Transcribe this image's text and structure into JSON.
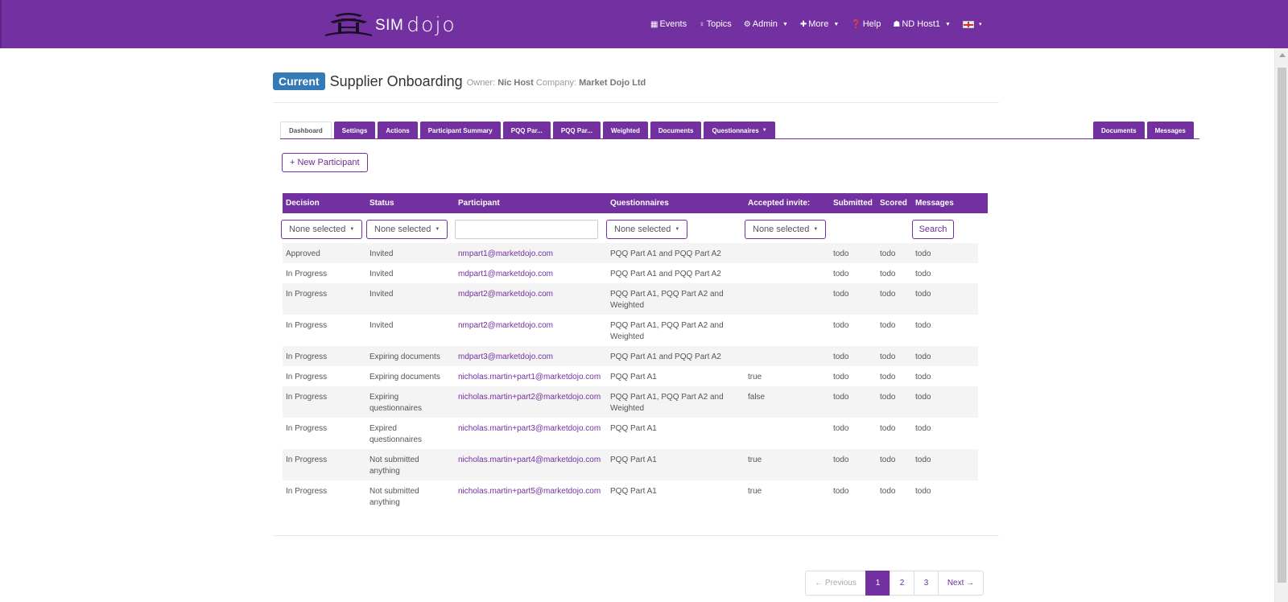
{
  "nav": {
    "brand_sim": "SIM",
    "brand_dojo": "dojo",
    "items": [
      {
        "icon": "calendar-icon",
        "glyph": "▦",
        "label": "Events",
        "caret": ""
      },
      {
        "icon": "lightbulb-icon",
        "glyph": "♀",
        "label": "Topics",
        "caret": ""
      },
      {
        "icon": "cogs-icon",
        "glyph": "⚙",
        "label": "Admin",
        "caret": "▼"
      },
      {
        "icon": "plus-icon",
        "glyph": "✚",
        "label": "More",
        "caret": "▼"
      },
      {
        "icon": "question-icon",
        "glyph": "❓",
        "label": "Help",
        "caret": ""
      },
      {
        "icon": "user-icon",
        "glyph": "☗",
        "label": "ND Host1",
        "caret": "▼"
      }
    ],
    "language_caret": "▾"
  },
  "header": {
    "badge": "Current",
    "title": "Supplier Onboarding",
    "owner_label": "Owner:",
    "owner": "Nic Host",
    "company_label": "Company:",
    "company": "Market Dojo Ltd"
  },
  "tabs": {
    "left": [
      "Dashboard",
      "Settings",
      "Actions",
      "Participant Summary",
      "PQQ Par...",
      "PQQ Par...",
      "Weighted",
      "Documents",
      "Questionnaires"
    ],
    "questionnaires_caret": "▼",
    "right": [
      "Documents",
      "Messages"
    ],
    "active": "Dashboard"
  },
  "new_participant_label": "+ New Participant",
  "table": {
    "columns": [
      "Decision",
      "Status",
      "Participant",
      "Questionnaires",
      "Accepted invite:",
      "Submitted",
      "Scored",
      "Messages"
    ],
    "filters": {
      "decision": "None selected",
      "status": "None selected",
      "participant": "",
      "questionnaires": "None selected",
      "accepted": "None selected",
      "search_label": "Search"
    },
    "rows": [
      {
        "decision": "Approved",
        "status": [
          "Invited"
        ],
        "participant": "nmpart1@marketdojo.com",
        "questionnaires": [
          "PQQ Part A1 and PQQ Part A2"
        ],
        "accepted": "",
        "submitted": "todo",
        "scored": "todo",
        "messages": "todo"
      },
      {
        "decision": "In Progress",
        "status": [
          "Invited"
        ],
        "participant": "mdpart1@marketdojo.com",
        "questionnaires": [
          "PQQ Part A1 and PQQ Part A2"
        ],
        "accepted": "",
        "submitted": "todo",
        "scored": "todo",
        "messages": "todo"
      },
      {
        "decision": "In Progress",
        "status": [
          "Invited"
        ],
        "participant": "mdpart2@marketdojo.com",
        "questionnaires": [
          "PQQ Part A1, PQQ Part A2 and",
          "Weighted"
        ],
        "accepted": "",
        "submitted": "todo",
        "scored": "todo",
        "messages": "todo"
      },
      {
        "decision": "In Progress",
        "status": [
          "Invited"
        ],
        "participant": "nmpart2@marketdojo.com",
        "questionnaires": [
          "PQQ Part A1, PQQ Part A2 and",
          "Weighted"
        ],
        "accepted": "",
        "submitted": "todo",
        "scored": "todo",
        "messages": "todo"
      },
      {
        "decision": "In Progress",
        "status": [
          "Expiring documents"
        ],
        "participant": "mdpart3@marketdojo.com",
        "questionnaires": [
          "PQQ Part A1 and PQQ Part A2"
        ],
        "accepted": "",
        "submitted": "todo",
        "scored": "todo",
        "messages": "todo"
      },
      {
        "decision": "In Progress",
        "status": [
          "Expiring documents"
        ],
        "participant": "nicholas.martin+part1@marketdojo.com",
        "questionnaires": [
          "PQQ Part A1"
        ],
        "accepted": "true",
        "submitted": "todo",
        "scored": "todo",
        "messages": "todo"
      },
      {
        "decision": "In Progress",
        "status": [
          "Expiring",
          "questionnaires"
        ],
        "participant": "nicholas.martin+part2@marketdojo.com",
        "questionnaires": [
          "PQQ Part A1, PQQ Part A2 and",
          "Weighted"
        ],
        "accepted": "false",
        "submitted": "todo",
        "scored": "todo",
        "messages": "todo"
      },
      {
        "decision": "In Progress",
        "status": [
          "Expired",
          "questionnaires"
        ],
        "participant": "nicholas.martin+part3@marketdojo.com",
        "questionnaires": [
          "PQQ Part A1"
        ],
        "accepted": "",
        "submitted": "todo",
        "scored": "todo",
        "messages": "todo"
      },
      {
        "decision": "In Progress",
        "status": [
          "Not submitted",
          "anything"
        ],
        "participant": "nicholas.martin+part4@marketdojo.com",
        "questionnaires": [
          "PQQ Part A1"
        ],
        "accepted": "true",
        "submitted": "todo",
        "scored": "todo",
        "messages": "todo"
      },
      {
        "decision": "In Progress",
        "status": [
          "Not submitted",
          "anything"
        ],
        "participant": "nicholas.martin+part5@marketdojo.com",
        "questionnaires": [
          "PQQ Part A1"
        ],
        "accepted": "true",
        "submitted": "todo",
        "scored": "todo",
        "messages": "todo"
      }
    ]
  },
  "pagination": {
    "previous": "← Previous",
    "pages": [
      "1",
      "2",
      "3"
    ],
    "current": "1",
    "next": "Next →"
  },
  "colors": {
    "brand_purple": "#7230a0",
    "badge_blue": "#337ab7"
  }
}
